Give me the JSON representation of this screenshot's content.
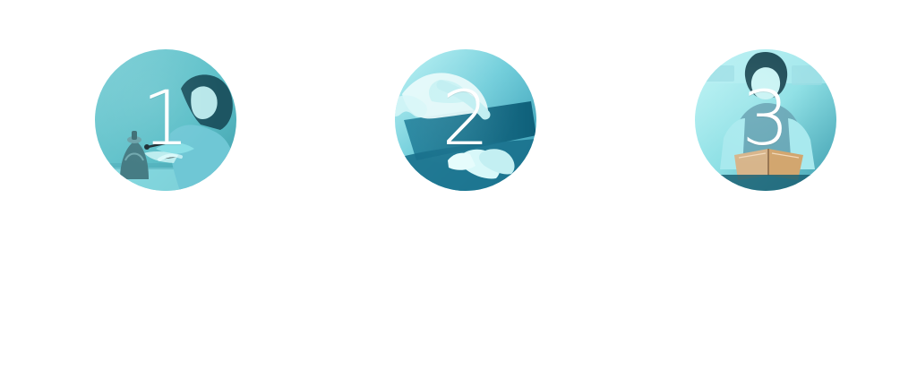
{
  "steps": [
    {
      "number": "1",
      "icon": "woman-painting-vase-photo-icon",
      "colors": {
        "background": "#65c2cb",
        "highlight": "#8bdde1",
        "shadow": "#3f9ca9"
      }
    },
    {
      "number": "2",
      "icon": "hand-touching-tablet-photo-icon",
      "colors": {
        "background": "#55bfd1",
        "highlight": "#9be8ef",
        "shadow": "#0f5f78"
      }
    },
    {
      "number": "3",
      "icon": "woman-reading-book-photo-icon",
      "colors": {
        "background": "#77d5df",
        "highlight": "#b4f2f4",
        "shadow": "#2d7f92"
      }
    }
  ]
}
